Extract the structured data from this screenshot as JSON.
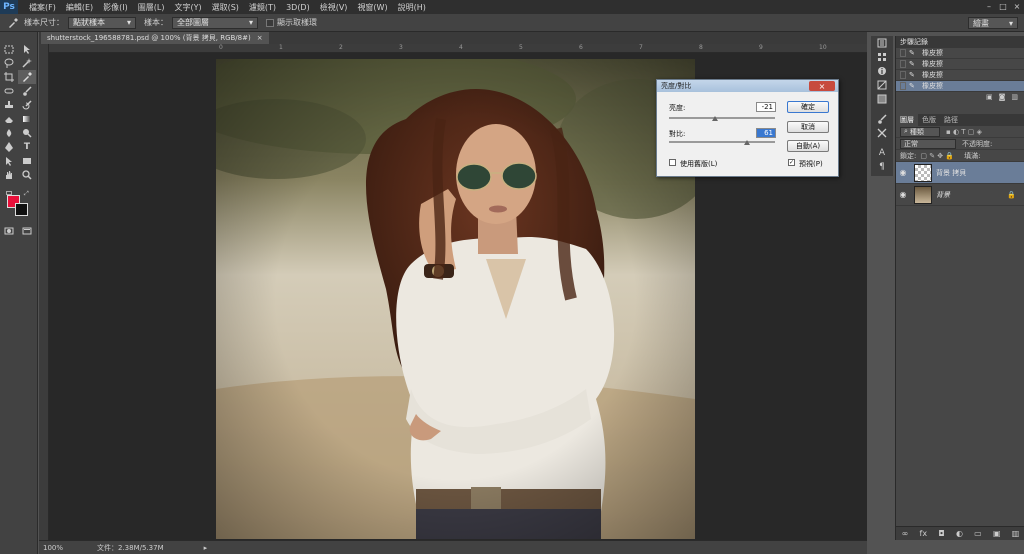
{
  "app": {
    "logo": "Ps"
  },
  "menu": [
    "檔案(F)",
    "編輯(E)",
    "影像(I)",
    "圖層(L)",
    "文字(Y)",
    "選取(S)",
    "濾鏡(T)",
    "3D(D)",
    "檢視(V)",
    "視窗(W)",
    "說明(H)"
  ],
  "window_controls": {
    "minimize": "–",
    "maximize": "□",
    "close": "×"
  },
  "options": {
    "sample_size_label": "樣本尺寸：",
    "sample_size_value": "點狀樣本",
    "sample_label": "樣本：",
    "sample_value": "全部圖層",
    "show_ring_label": "顯示取樣環",
    "workspace_value": "繪畫"
  },
  "document": {
    "tab_title": "shutterstock_196588781.psd @ 100% (背景 拷貝, RGB/8#)",
    "tab_close": "×",
    "ruler_ticks": [
      "0",
      "1",
      "2",
      "3",
      "4",
      "5",
      "6",
      "7",
      "8",
      "9",
      "10"
    ],
    "zoom": "100%",
    "file_info": "文件：2.38M/5.37M",
    "status_arrow": "▸"
  },
  "dialog": {
    "title": "亮度/對比",
    "close": "×",
    "brightness_label": "亮度:",
    "brightness_value": "-21",
    "contrast_label": "對比:",
    "contrast_value": "61",
    "ok": "確定",
    "cancel": "取消",
    "auto": "自動(A)",
    "use_legacy_label": "使用舊版(L)",
    "preview_label": "預視(P)",
    "preview_checked": "✓",
    "brightness_level": -21,
    "contrast_level": 61
  },
  "history": {
    "tab": "步驟記錄",
    "items": [
      "橡皮擦",
      "橡皮擦",
      "橡皮擦",
      "橡皮擦"
    ]
  },
  "layers": {
    "tabs": [
      "圖層",
      "色版",
      "路徑"
    ],
    "filter_label": "種類",
    "blend_mode": "正常",
    "opacity_label": "不透明度:",
    "lock_label": "鎖定:",
    "fill_label": "填滿:",
    "items": [
      {
        "name": "背景 拷貝",
        "selected": true
      },
      {
        "name": "背景",
        "locked": true
      }
    ],
    "lock_icon": "🔒"
  },
  "colors": {
    "foreground": "#e8103a",
    "background": "#111111",
    "selection": "#6a7d98",
    "ps_blue": "#6fb6ff"
  }
}
